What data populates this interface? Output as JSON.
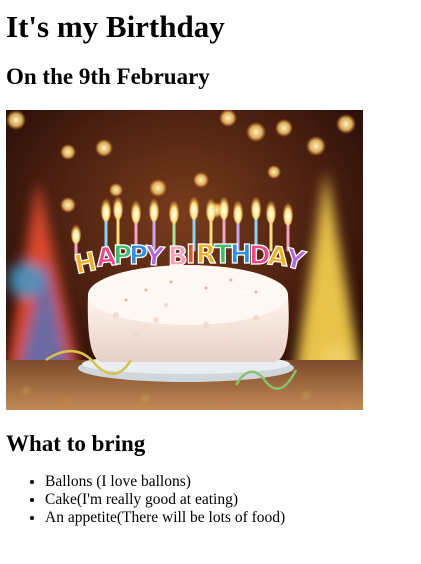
{
  "page": {
    "title": "It's my Birthday",
    "subtitle": "On the 9th February",
    "image": {
      "banner_text": "HAPPY BIRTHDAY"
    },
    "bring_heading": "What to bring",
    "bring_items": [
      "Ballons (I love ballons)",
      "Cake(I'm really good at eating)",
      "An appetite(There will be lots of food)"
    ]
  },
  "colors": {
    "background": "#ffffff",
    "text": "#000000"
  }
}
